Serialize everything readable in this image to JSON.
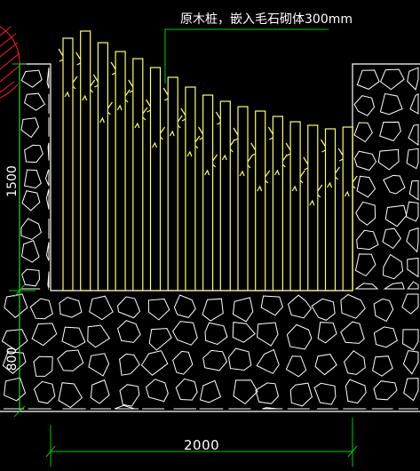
{
  "callout_text": "原木桩，嵌入毛石砌体300mm",
  "dimensions": {
    "horizontal": "2000",
    "upper_vertical": "1500",
    "lower_vertical": "800"
  },
  "colors": {
    "background": "#000000",
    "posts": "#ffff66",
    "stone": "#ffffff",
    "dimension_lines": "#00cc00",
    "ground_line": "#ffffff",
    "hatch_arc": "#ff2020"
  },
  "post_count": 17
}
